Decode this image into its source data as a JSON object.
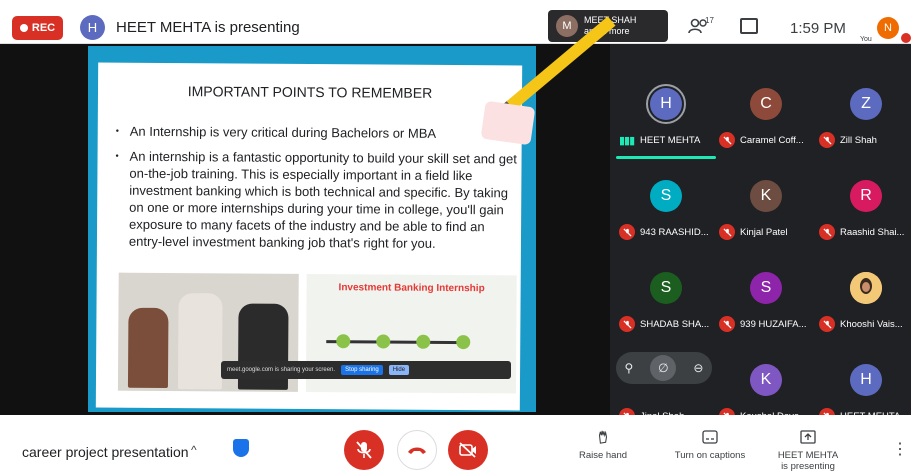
{
  "topbar": {
    "rec_label": "REC",
    "presenter_initial": "H",
    "presenting_text": "HEET MEHTA is presenting",
    "share_avatar": "M",
    "share_name_line1": "MEET SHAH",
    "share_name_line2": "and 2 more",
    "people_count": "17",
    "clock": "1:59 PM",
    "you_label": "You",
    "you_initial": "N"
  },
  "slide": {
    "title": "IMPORTANT POINTS TO REMEMBER",
    "bullet1": "An Internship is very critical during Bachelors or MBA",
    "bullet2": "An internship is a fantastic opportunity to build your skill set and get on-the-job training. This is especially important in a field like investment banking which is both technical and specific. By taking on one or more internships during your time in college, you'll gain exposure to many facets of the industry and be able to find an entry-level investment banking job that's right for you.",
    "infographic_title": "Investment Banking Internship",
    "toast_text": "meet.google.com is sharing your screen.",
    "toast_stop": "Stop sharing",
    "toast_hide": "Hide"
  },
  "participants": [
    {
      "initial": "H",
      "name": "HEET MEHTA",
      "color": "#5c6bc0",
      "speaking": true
    },
    {
      "initial": "C",
      "name": "Caramel Coff...",
      "color": "#8d4a3b",
      "speaking": false
    },
    {
      "initial": "Z",
      "name": "Zill Shah",
      "color": "#5c6bc0",
      "speaking": false
    },
    {
      "initial": "S",
      "name": "943 RAASHID...",
      "color": "#00acc1",
      "speaking": false
    },
    {
      "initial": "K",
      "name": "Kinjal Patel",
      "color": "#6d4c41",
      "speaking": false
    },
    {
      "initial": "R",
      "name": "Raashid Shai...",
      "color": "#d81b60",
      "speaking": false
    },
    {
      "initial": "S",
      "name": "SHADAB SHA...",
      "color": "#1b5e20",
      "speaking": false
    },
    {
      "initial": "S",
      "name": "939 HUZAIFA...",
      "color": "#8e24aa",
      "speaking": false
    },
    {
      "initial": "",
      "name": "Khooshi Vais...",
      "color": "#f3c977",
      "speaking": false
    },
    {
      "initial": "",
      "name": "Jinal Shah",
      "color": "#202124",
      "speaking": false
    },
    {
      "initial": "K",
      "name": "Kaushal Dave",
      "color": "#7e57c2",
      "speaking": false
    },
    {
      "initial": "H",
      "name": "HEET MEHTA",
      "color": "#5c6bc0",
      "speaking": false
    }
  ],
  "bottombar": {
    "meeting_name": "career project presentation",
    "raise_hand": "Raise hand",
    "captions": "Turn on captions",
    "present_line1": "HEET MEHTA",
    "present_line2": "is presenting"
  }
}
